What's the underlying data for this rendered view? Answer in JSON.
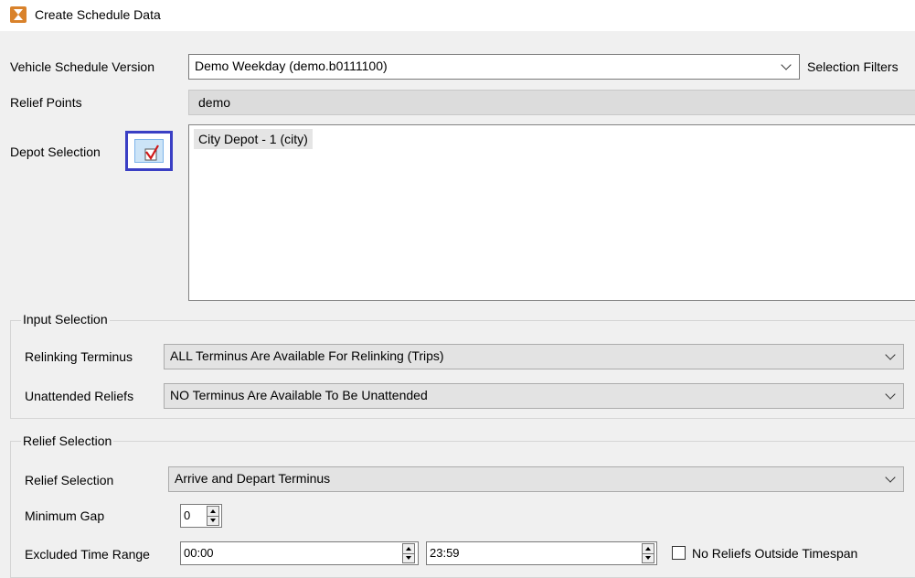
{
  "window": {
    "title": "Create Schedule Data"
  },
  "vehicle_schedule": {
    "label": "Vehicle Schedule Version",
    "value": "Demo Weekday (demo.b0111100)",
    "filters_label": "Selection Filters"
  },
  "relief_points": {
    "label": "Relief Points",
    "value": "demo"
  },
  "depot_selection": {
    "label": "Depot Selection",
    "items": [
      "City Depot - 1 (city)"
    ]
  },
  "input_selection": {
    "title": "Input Selection",
    "relinking": {
      "label": "Relinking Terminus",
      "value": "ALL Terminus Are Available For Relinking (Trips)"
    },
    "unattended": {
      "label": "Unattended Reliefs",
      "value": "NO Terminus Are Available To Be Unattended"
    }
  },
  "relief_selection_group": {
    "title": "Relief Selection",
    "relief_selection": {
      "label": "Relief Selection",
      "value": "Arrive and Depart Terminus"
    },
    "minimum_gap": {
      "label": "Minimum Gap",
      "value": "0"
    },
    "excluded_time": {
      "label": "Excluded Time Range",
      "start": "00:00",
      "end": "23:59"
    },
    "no_reliefs": {
      "label": "No Reliefs Outside Timespan",
      "checked": false
    }
  },
  "colors": {
    "focus_border": "#3a3fc4",
    "check_red": "#d01818",
    "button_blue": "#cce4f7"
  }
}
